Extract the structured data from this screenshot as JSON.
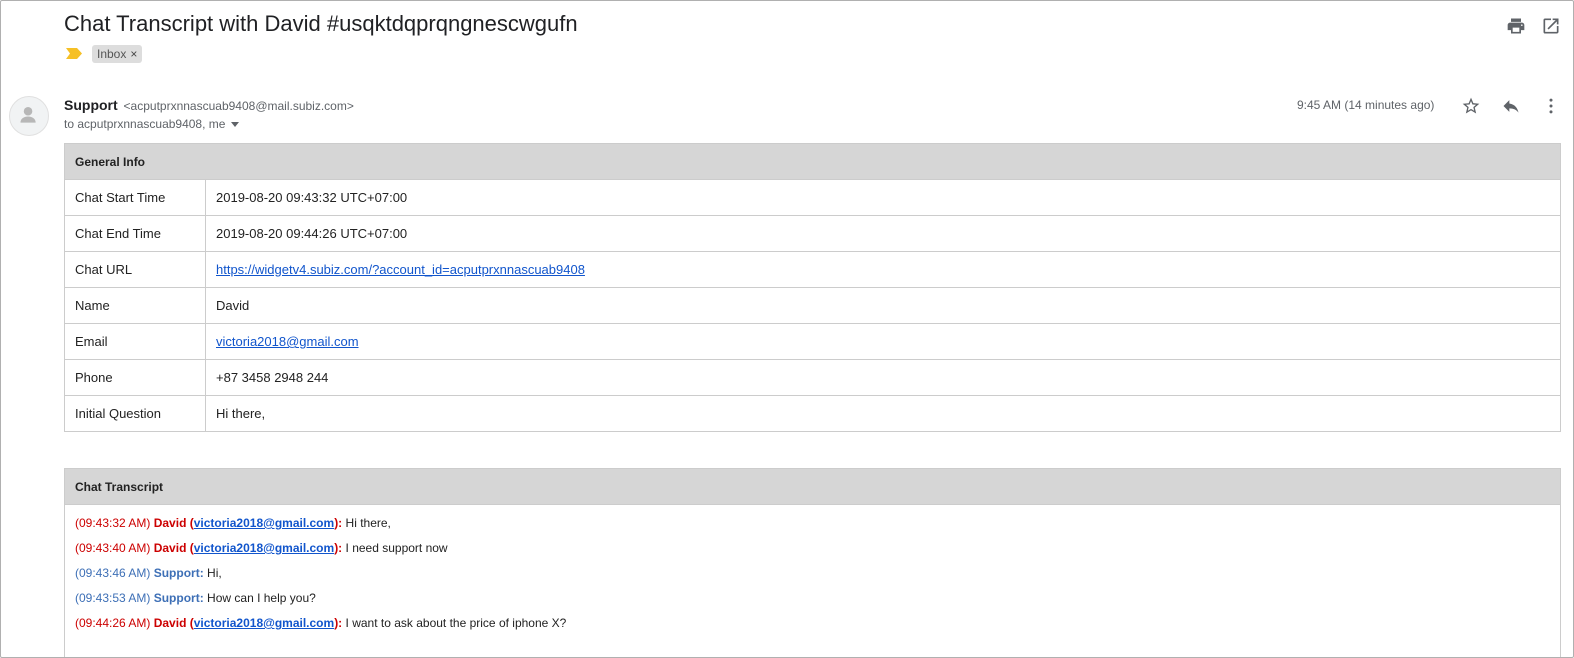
{
  "email": {
    "subject": "Chat Transcript with David #usqktdqprqngnescwgufn",
    "label_chip": "Inbox",
    "label_remove": "×",
    "sender_name": "Support",
    "sender_email": "<acputprxnnascuab9408@mail.subiz.com>",
    "recipients": "to acputprxnnascuab9408, me",
    "time": "9:45 AM (14 minutes ago)"
  },
  "info_table": {
    "header": "General Info",
    "rows": [
      {
        "label": "Chat Start Time",
        "value": "2019-08-20 09:43:32 UTC+07:00"
      },
      {
        "label": "Chat End Time",
        "value": "2019-08-20 09:44:26 UTC+07:00"
      },
      {
        "label": "Chat URL",
        "value": "https://widgetv4.subiz.com/?account_id=acputprxnnascuab9408"
      },
      {
        "label": "Name",
        "value": "David"
      },
      {
        "label": "Email",
        "value": "victoria2018@gmail.com"
      },
      {
        "label": "Phone",
        "value": "+87 3458 2948 244"
      },
      {
        "label": "Initial Question",
        "value": "Hi there,"
      }
    ]
  },
  "transcript": {
    "header": "Chat Transcript",
    "lines": [
      {
        "time": "(09:43:32 AM)",
        "name": "David",
        "email": "victoria2018@gmail.com",
        "open": " (",
        "close": "):",
        "text": " Hi there,"
      },
      {
        "time": "(09:43:40 AM)",
        "name": "David",
        "email": "victoria2018@gmail.com",
        "open": " (",
        "close": "):",
        "text": " I need support now"
      },
      {
        "time": "(09:43:46 AM)",
        "name": "Support:",
        "text": " Hi,"
      },
      {
        "time": "(09:43:53 AM)",
        "name": "Support:",
        "text": " How can I help you?"
      },
      {
        "time": "(09:44:26 AM)",
        "name": "David",
        "email": "victoria2018@gmail.com",
        "open": " (",
        "close": "):",
        "text": " I want to ask about the price of iphone X?"
      }
    ]
  },
  "colors": {
    "user": "#cc0000",
    "agent": "#3d6fb6",
    "link": "#1155cc",
    "header_bg": "#d6d6d6",
    "importance": "#f6c026"
  },
  "icons": {
    "importance": "importance-marker-icon",
    "print": "print-icon",
    "new_window": "open-in-new-window-icon",
    "avatar": "person-icon",
    "star": "star-icon",
    "reply": "reply-icon",
    "more": "more-vert-icon",
    "recipients_caret": "chevron-down-icon"
  }
}
